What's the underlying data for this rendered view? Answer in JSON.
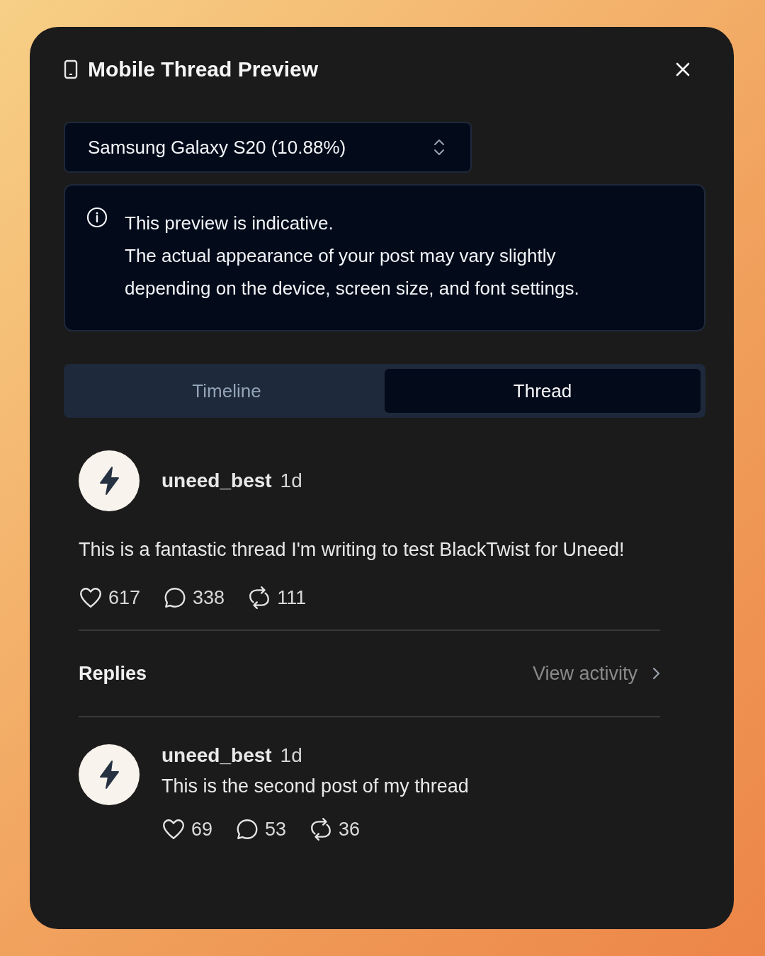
{
  "dialog": {
    "title": "Mobile Thread Preview"
  },
  "device_select": {
    "value": "Samsung Galaxy S20 (10.88%)"
  },
  "notice": {
    "paragraphs": [
      "This preview is indicative.",
      "The actual appearance of your post may vary slightly depending on the device, screen size, and font settings."
    ]
  },
  "tabs": [
    {
      "label": "Timeline",
      "selected": false
    },
    {
      "label": "Thread",
      "selected": true
    }
  ],
  "post": {
    "author": "uneed_best",
    "time": "1d",
    "text": "This is a fantastic thread I'm writing to test BlackTwist for Uneed!",
    "stats": [
      {
        "kind": "like",
        "count": "617"
      },
      {
        "kind": "reply",
        "count": "338"
      },
      {
        "kind": "repost",
        "count": "111"
      }
    ]
  },
  "replies_header": {
    "title": "Replies",
    "link": "View activity"
  },
  "replies": [
    {
      "author": "uneed_best",
      "time": "1d",
      "text": "This is the second post of my thread",
      "stats": [
        {
          "kind": "like",
          "count": "69"
        },
        {
          "kind": "reply",
          "count": "53"
        },
        {
          "kind": "repost",
          "count": "36"
        }
      ]
    }
  ]
}
